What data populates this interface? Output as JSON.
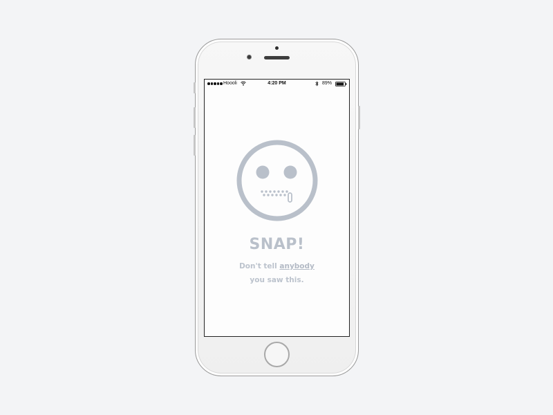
{
  "status_bar": {
    "carrier": "Hoooli",
    "time": "4:20 PM",
    "battery": "89%",
    "battery_level": 0.89,
    "icons": [
      "signal-dots-icon",
      "wifi-icon",
      "bluetooth-icon",
      "battery-icon"
    ]
  },
  "main": {
    "icon": "zipped-mouth-face-icon",
    "title": "SNAP!",
    "message_prefix": "Don't tell",
    "message_link": "anybody",
    "message_suffix": "you saw this."
  },
  "colors": {
    "background": "#f3f4f6",
    "accent": "#b9c0ca",
    "screen": "#fdfdfd"
  }
}
